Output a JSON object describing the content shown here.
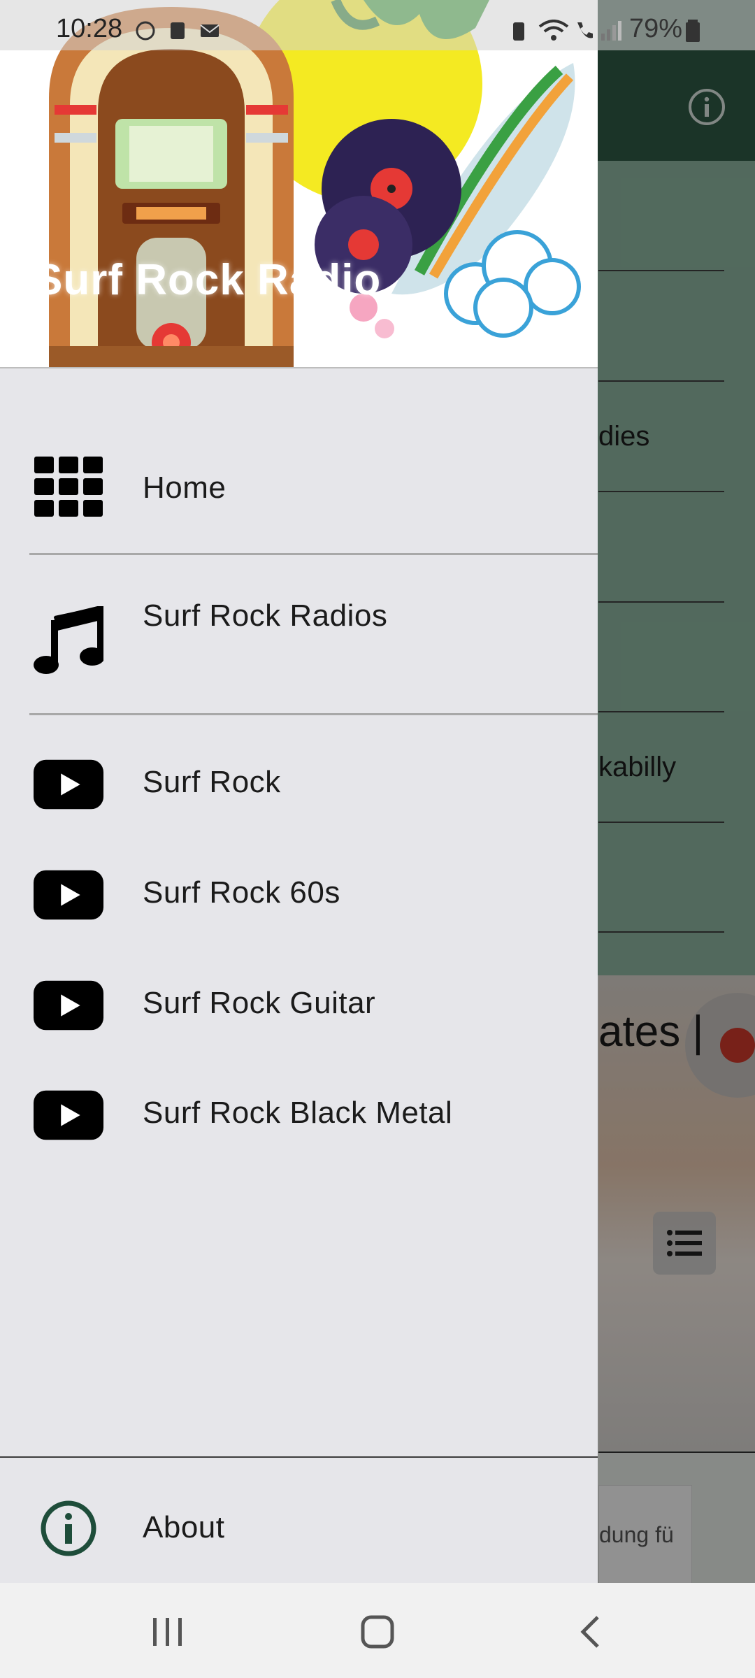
{
  "status_bar": {
    "time": "10:28",
    "battery": "79%"
  },
  "background_app": {
    "list_fragments": [
      "dies",
      "kabilly"
    ],
    "headline_fragment": "ates |",
    "banner_fragment": "dung fü"
  },
  "drawer": {
    "header_title": "Surf Rock Radio",
    "items": [
      {
        "label": "Home",
        "icon": "grid-icon"
      },
      {
        "label": "Surf Rock Radios",
        "icon": "music-note-icon"
      },
      {
        "label": "Surf Rock",
        "icon": "youtube-icon"
      },
      {
        "label": "Surf Rock 60s",
        "icon": "youtube-icon"
      },
      {
        "label": "Surf Rock Guitar",
        "icon": "youtube-icon"
      },
      {
        "label": "Surf Rock Black Metal",
        "icon": "youtube-icon"
      }
    ],
    "about_label": "About"
  },
  "colors": {
    "accent": "#1e4d3a",
    "appbar": "#2f5a46",
    "drawer_bg": "#e6e6ea"
  }
}
